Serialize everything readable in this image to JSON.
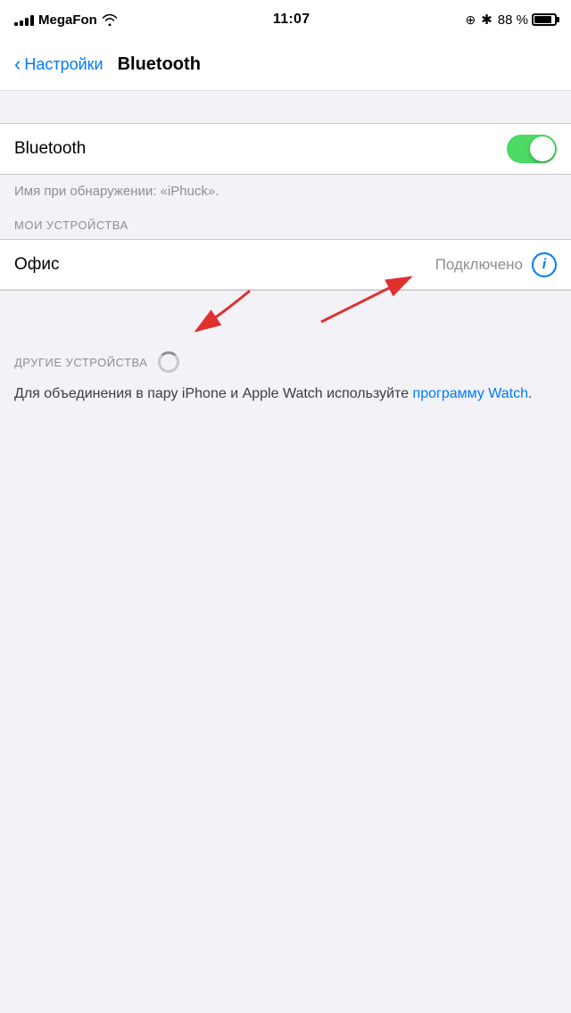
{
  "statusBar": {
    "carrier": "MegaFon",
    "time": "11:07",
    "battery": "88 %"
  },
  "navBar": {
    "backLabel": "Настройки",
    "title": "Bluetooth"
  },
  "bluetoothSection": {
    "label": "Bluetooth",
    "toggleOn": true
  },
  "discoveryText": "Имя при обнаружении: «iPhuck».",
  "myDevicesHeader": "МОИ УСТРОЙСТВА",
  "devices": [
    {
      "name": "Офис",
      "status": "Подключено"
    }
  ],
  "otherDevicesHeader": "ДРУГИЕ УСТРОЙСТВА",
  "descriptionText": "Для объединения в пару iPhone и Apple Watch используйте ",
  "descriptionLink": "программу Watch",
  "descriptionTextEnd": "."
}
